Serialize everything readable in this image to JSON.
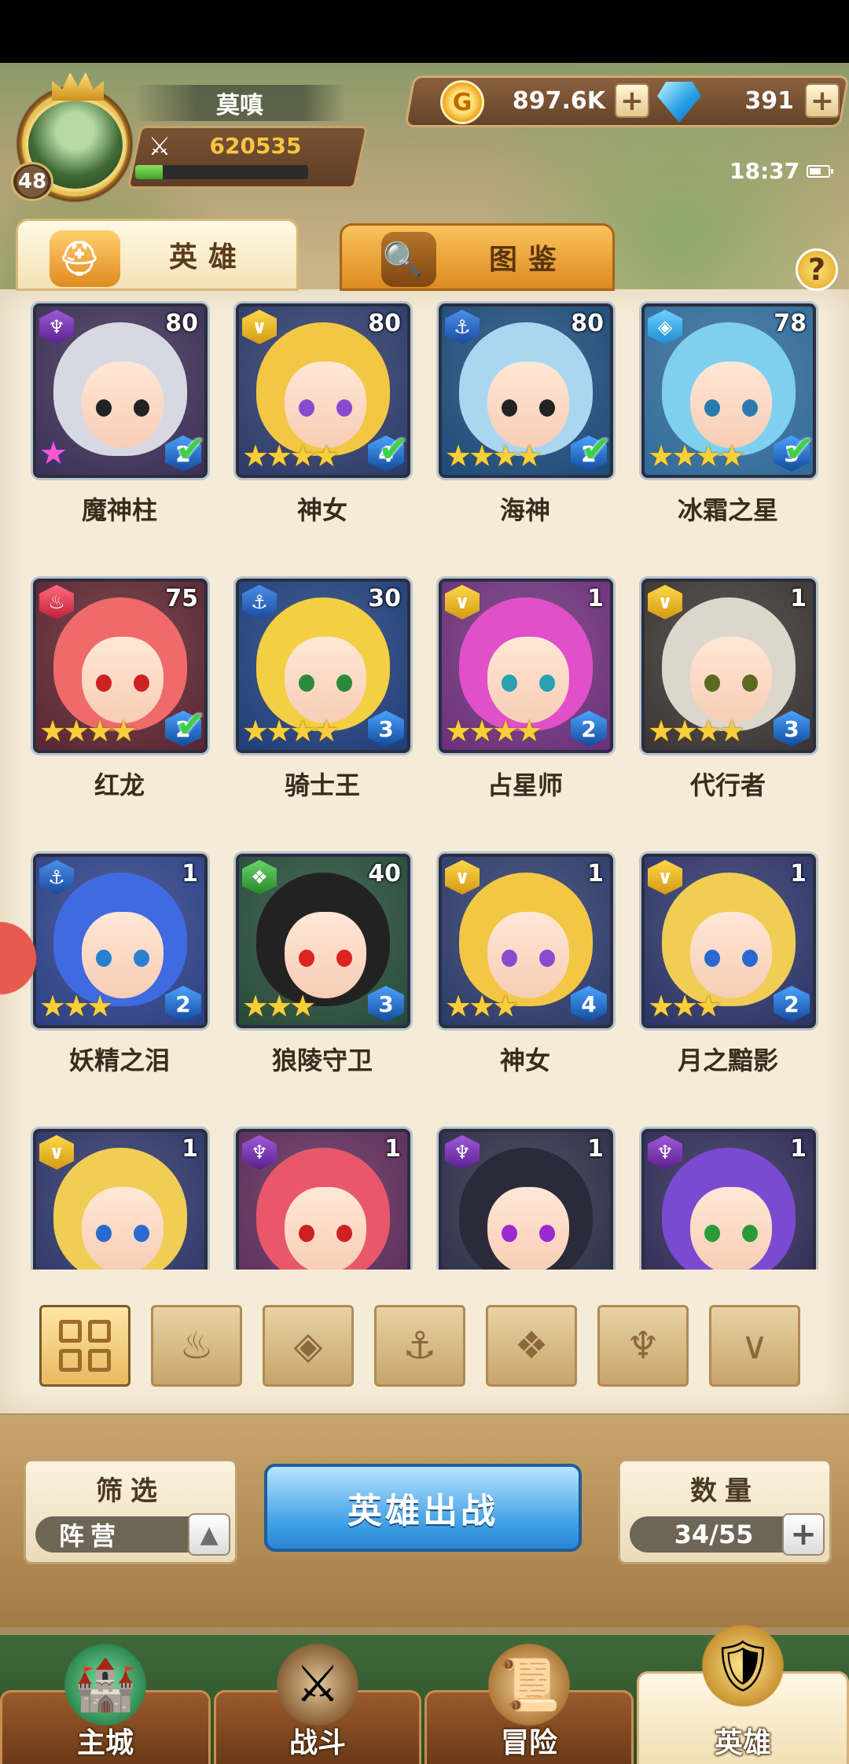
{
  "player": {
    "name": "莫嗔",
    "level": "48",
    "power": "620535",
    "exp_progress": 0.16
  },
  "resources": {
    "gold": "897.6K",
    "gems": "391"
  },
  "status": {
    "time": "18:37"
  },
  "tabs": [
    {
      "label": "英雄",
      "active": true
    },
    {
      "label": "图鉴",
      "active": false
    }
  ],
  "help_label": "?",
  "factions": [
    "all",
    "fire",
    "ice",
    "anchor",
    "beast",
    "dark",
    "light"
  ],
  "heroes": [
    {
      "name": "魔神柱",
      "level": "80",
      "grade": "2",
      "stars": 0,
      "faction": "dark",
      "check": true,
      "special_star": true
    },
    {
      "name": "神女",
      "level": "80",
      "grade": "4",
      "stars": 4,
      "faction": "light",
      "check": true
    },
    {
      "name": "海神",
      "level": "80",
      "grade": "2",
      "stars": 4,
      "faction": "anchor",
      "check": true
    },
    {
      "name": "冰霜之星",
      "level": "78",
      "grade": "3",
      "stars": 4,
      "faction": "ice",
      "check": true
    },
    {
      "name": "红龙",
      "level": "75",
      "grade": "2",
      "stars": 4,
      "faction": "fire",
      "check": true
    },
    {
      "name": "骑士王",
      "level": "30",
      "grade": "3",
      "stars": 4,
      "faction": "anchor",
      "check": false
    },
    {
      "name": "占星师",
      "level": "1",
      "grade": "2",
      "stars": 4,
      "faction": "light",
      "check": false
    },
    {
      "name": "代行者",
      "level": "1",
      "grade": "3",
      "stars": 4,
      "faction": "light",
      "check": false
    },
    {
      "name": "妖精之泪",
      "level": "1",
      "grade": "2",
      "stars": 3,
      "faction": "anchor",
      "check": false
    },
    {
      "name": "狼陵守卫",
      "level": "40",
      "grade": "3",
      "stars": 3,
      "faction": "beast",
      "check": false
    },
    {
      "name": "神女",
      "level": "1",
      "grade": "4",
      "stars": 3,
      "faction": "light",
      "check": false
    },
    {
      "name": "月之黯影",
      "level": "1",
      "grade": "2",
      "stars": 3,
      "faction": "light",
      "check": false
    },
    {
      "name": "",
      "level": "1",
      "grade": "",
      "stars": 0,
      "faction": "light",
      "check": false
    },
    {
      "name": "",
      "level": "1",
      "grade": "",
      "stars": 0,
      "faction": "dark",
      "check": false
    },
    {
      "name": "",
      "level": "1",
      "grade": "",
      "stars": 0,
      "faction": "dark",
      "check": false
    },
    {
      "name": "",
      "level": "1",
      "grade": "",
      "stars": 0,
      "faction": "dark",
      "check": false
    }
  ],
  "controls": {
    "filter_title": "筛选",
    "filter_value": "阵营",
    "deploy_label": "英雄出战",
    "count_title": "数量",
    "count_value": "34/55"
  },
  "nav": [
    {
      "label": "主城"
    },
    {
      "label": "战斗"
    },
    {
      "label": "冒险"
    },
    {
      "label": "英雄",
      "active": true
    }
  ]
}
